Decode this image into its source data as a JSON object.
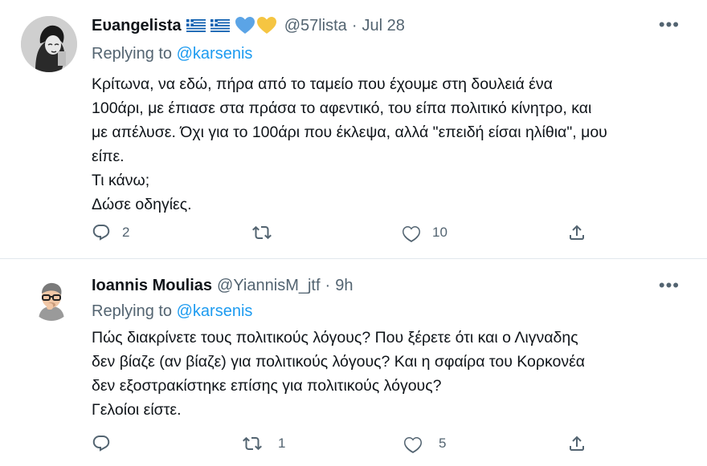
{
  "tweets": [
    {
      "name": "Ευangelista",
      "handle": "@57lista",
      "dot": "·",
      "time": "Jul 28",
      "more": "•••",
      "replying_prefix": "Replying to ",
      "replying_to": "@karsenis",
      "text": "Κρίτωνα, να εδώ, πήρα από το ταμείο που έχουμε στη δουλειά ένα\n100άρι, με έπιασε στα πράσα το αφεντικό, του είπα πολιτικό κίνητρο, και\nμε απέλυσε. Όχι για το 100άρι που έκλεψα, αλλά \"επειδή είσαι ηλίθια\", μου\nείπε.\nΤι κάνω;\nΔώσε οδηγίες.",
      "reply_count": "2",
      "retweet_count": "",
      "like_count": "10"
    },
    {
      "name": "Ioannis Moulias",
      "handle": "@YiannisM_jtf",
      "dot": "·",
      "time": "9h",
      "more": "•••",
      "replying_prefix": "Replying to ",
      "replying_to": "@karsenis",
      "text": "Πώς διακρίνετε τους πολιτικούς λόγους? Που ξέρετε ότι και ο Λιγναδης\nδεν βίαζε (αν βίαζε) για πολιτικούς λόγους? Και η σφαίρα του Κορκονέα\nδεν εξοστρακίστηκε επίσης για πολιτικούς λόγους?\nΓελοίοι είστε.",
      "reply_count": "",
      "retweet_count": "1",
      "like_count": "5"
    }
  ],
  "colors": {
    "text": "#0f1419",
    "muted": "#536471",
    "link": "#1d9bf0",
    "border": "#e1e8ed",
    "flag_blue": "#0d5eaf",
    "heart_blue": "#5ba4e6",
    "heart_yellow": "#f5c542"
  },
  "icons": [
    "reply-icon",
    "retweet-icon",
    "like-icon",
    "share-icon",
    "more-icon",
    "greek-flag-icon",
    "blue-heart-icon",
    "yellow-heart-icon"
  ]
}
